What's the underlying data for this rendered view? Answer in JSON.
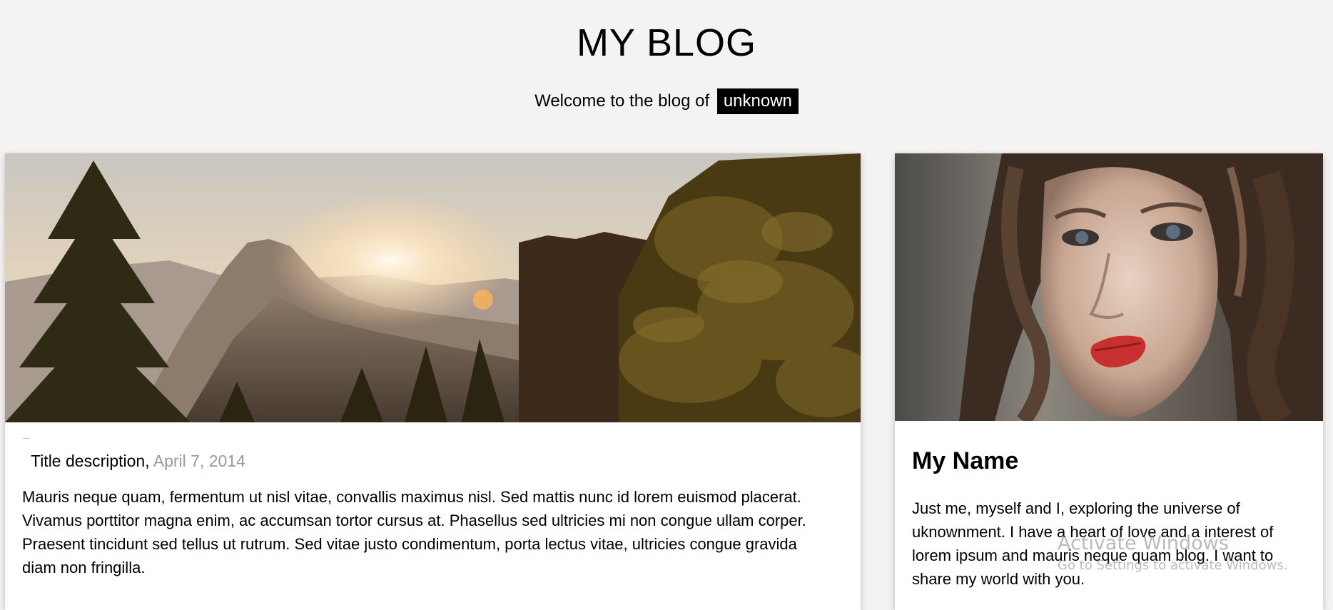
{
  "header": {
    "title": "MY BLOG",
    "welcome_text": "Welcome to the blog of",
    "welcome_tag": "unknown"
  },
  "post": {
    "title": "Title description,",
    "date": "April 7, 2014",
    "text": "Mauris neque quam, fermentum ut nisl vitae, convallis maximus nisl. Sed mattis nunc id lorem euismod placerat. Vivamus porttitor magna enim, ac accumsan tortor cursus at. Phasellus sed ultricies mi non congue ullam corper. Praesent tincidunt sed tellus ut rutrum. Sed vitae justo condimentum, porta lectus vitae, ultricies congue gravida diam non fringilla."
  },
  "profile": {
    "name": "My Name",
    "text": "Just me, myself and I, exploring the universe of uknownment. I have a heart of love and a interest of lorem ipsum and mauris neque quam blog. I want to share my world with you."
  },
  "watermark": {
    "line1": "Activate Windows",
    "line2": "Go to Settings to activate Windows."
  },
  "colors": {
    "background": "#f4f3f2",
    "tag_background": "#000000",
    "date_color": "#999999"
  }
}
